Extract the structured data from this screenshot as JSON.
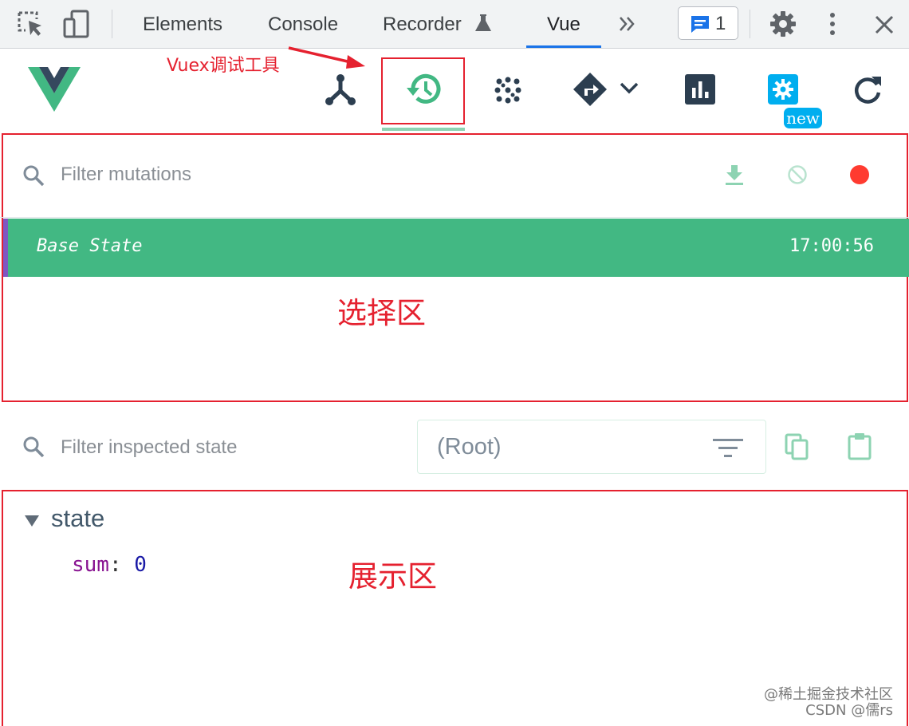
{
  "devtools": {
    "tabs": [
      "Elements",
      "Console",
      "Recorder",
      "Vue"
    ],
    "active_tab": "Vue",
    "issues_count": "1",
    "icons": [
      "inspect-element-icon",
      "device-toolbar-icon",
      "flask-icon",
      "more-tabs-icon",
      "message-icon",
      "gear-icon",
      "kebab-menu-icon",
      "close-icon"
    ]
  },
  "vue_toolbar": {
    "logo": "vue-logo",
    "buttons": [
      "components-icon",
      "timeline-history-icon",
      "vuex-store-icon",
      "routing-icon",
      "chevron-down-icon",
      "performance-chart-icon",
      "settings-icon",
      "refresh-icon"
    ],
    "new_badge": "new",
    "accent_color": "#42b883"
  },
  "annotations": {
    "vuex_tool": "Vuex调试工具",
    "selection_area": "选择区",
    "display_area": "展示区"
  },
  "mutations": {
    "filter_placeholder": "Filter mutations",
    "rows": [
      {
        "label": "Base State",
        "time": "17:00:56",
        "selected": true
      }
    ],
    "actions": [
      "download-icon",
      "clear-icon",
      "record-icon"
    ]
  },
  "inspector": {
    "filter_placeholder": "Filter inspected state",
    "root_select": "(Root)",
    "actions": [
      "filter-list-icon",
      "copy-icon",
      "paste-icon"
    ],
    "section": "state",
    "props": [
      {
        "key": "sum",
        "value": "0"
      }
    ]
  },
  "watermark": {
    "line1": "@稀土掘金技术社区",
    "line2": "CSDN @儒rs"
  }
}
